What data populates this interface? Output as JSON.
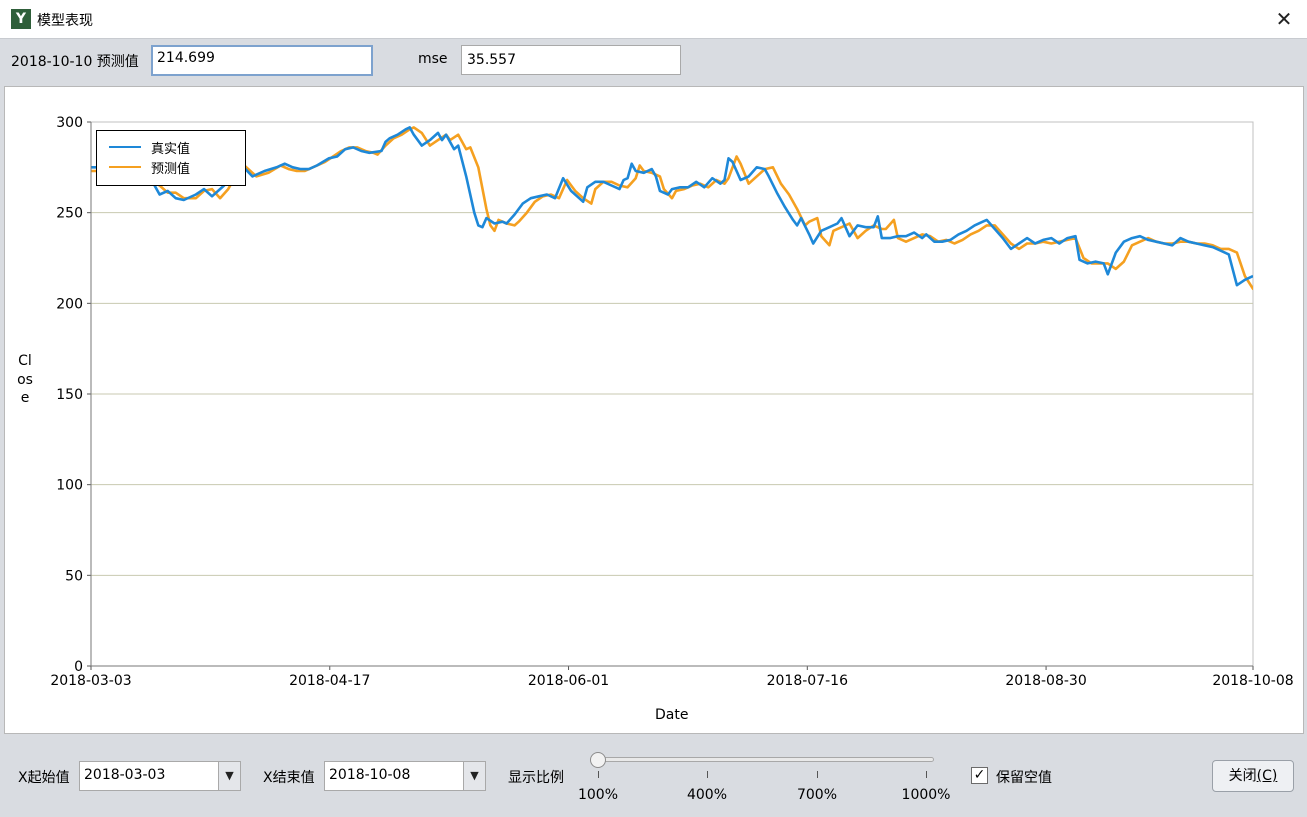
{
  "window": {
    "title": "模型表现",
    "icon_letter": "Y"
  },
  "top": {
    "pred_label": "2018-10-10 预测值",
    "pred_value": "214.699",
    "mse_label": "mse",
    "mse_value": "35.557"
  },
  "chart_data": {
    "type": "line",
    "xlabel": "Date",
    "ylabel": "Close",
    "ylim": [
      0,
      300
    ],
    "yticks": [
      0,
      50,
      100,
      150,
      200,
      250,
      300
    ],
    "xticks": [
      "2018-03-03",
      "2018-04-17",
      "2018-06-01",
      "2018-07-16",
      "2018-08-30",
      "2018-10-08"
    ],
    "x_range": [
      "2018-03-03",
      "2018-10-08"
    ],
    "grid": "horizontal",
    "legend": "top-left",
    "series": [
      {
        "name": "真实值",
        "color": "#1e88d8",
        "values": [
          [
            0,
            275
          ],
          [
            3,
            275
          ],
          [
            6,
            272
          ],
          [
            9,
            274
          ],
          [
            12,
            272
          ],
          [
            15,
            268
          ],
          [
            17,
            260
          ],
          [
            19,
            262
          ],
          [
            21,
            258
          ],
          [
            23,
            257
          ],
          [
            26,
            260
          ],
          [
            28,
            263
          ],
          [
            30,
            259
          ],
          [
            33,
            265
          ],
          [
            35,
            272
          ],
          [
            37,
            277
          ],
          [
            40,
            270
          ],
          [
            43,
            273
          ],
          [
            46,
            275
          ],
          [
            48,
            277
          ],
          [
            50,
            275
          ],
          [
            52,
            274
          ],
          [
            54,
            274
          ],
          [
            56,
            276
          ],
          [
            59,
            280
          ],
          [
            61,
            281
          ],
          [
            63,
            285
          ],
          [
            65,
            286
          ],
          [
            67,
            284
          ],
          [
            69,
            283
          ],
          [
            72,
            284
          ],
          [
            73,
            289
          ],
          [
            74,
            291
          ],
          [
            76,
            293
          ],
          [
            78,
            296
          ],
          [
            79,
            297
          ],
          [
            80,
            293
          ],
          [
            82,
            287
          ],
          [
            84,
            290
          ],
          [
            86,
            294
          ],
          [
            87,
            290
          ],
          [
            88,
            293
          ],
          [
            90,
            285
          ],
          [
            91,
            287
          ],
          [
            93,
            270
          ],
          [
            95,
            250
          ],
          [
            96,
            243
          ],
          [
            97,
            242
          ],
          [
            98,
            247
          ],
          [
            100,
            244
          ],
          [
            102,
            245
          ],
          [
            103,
            244
          ],
          [
            105,
            249
          ],
          [
            107,
            255
          ],
          [
            109,
            258
          ],
          [
            111,
            259
          ],
          [
            113,
            260
          ],
          [
            115,
            258
          ],
          [
            117,
            269
          ],
          [
            119,
            262
          ],
          [
            121,
            258
          ],
          [
            122,
            256
          ],
          [
            123,
            264
          ],
          [
            125,
            267
          ],
          [
            127,
            267
          ],
          [
            129,
            265
          ],
          [
            131,
            263
          ],
          [
            132,
            268
          ],
          [
            133,
            269
          ],
          [
            134,
            277
          ],
          [
            135,
            273
          ],
          [
            137,
            272
          ],
          [
            139,
            274
          ],
          [
            140,
            270
          ],
          [
            141,
            262
          ],
          [
            143,
            260
          ],
          [
            144,
            263
          ],
          [
            146,
            264
          ],
          [
            148,
            264
          ],
          [
            150,
            267
          ],
          [
            152,
            264
          ],
          [
            154,
            269
          ],
          [
            156,
            266
          ],
          [
            157,
            268
          ],
          [
            158,
            280
          ],
          [
            159,
            278
          ],
          [
            161,
            268
          ],
          [
            163,
            270
          ],
          [
            165,
            275
          ],
          [
            167,
            274
          ],
          [
            168,
            270
          ],
          [
            170,
            261
          ],
          [
            172,
            253
          ],
          [
            174,
            246
          ],
          [
            175,
            243
          ],
          [
            176,
            247
          ],
          [
            178,
            238
          ],
          [
            179,
            233
          ],
          [
            181,
            240
          ],
          [
            183,
            242
          ],
          [
            185,
            244
          ],
          [
            186,
            247
          ],
          [
            188,
            237
          ],
          [
            190,
            243
          ],
          [
            192,
            242
          ],
          [
            194,
            242
          ],
          [
            195,
            248
          ],
          [
            196,
            236
          ],
          [
            198,
            236
          ],
          [
            200,
            237
          ],
          [
            202,
            237
          ],
          [
            204,
            239
          ],
          [
            206,
            236
          ],
          [
            207,
            238
          ],
          [
            209,
            234
          ],
          [
            211,
            234
          ],
          [
            213,
            235
          ],
          [
            215,
            238
          ],
          [
            217,
            240
          ],
          [
            219,
            243
          ],
          [
            221,
            245
          ],
          [
            222,
            246
          ],
          [
            224,
            241
          ],
          [
            226,
            236
          ],
          [
            228,
            230
          ],
          [
            230,
            233
          ],
          [
            232,
            236
          ],
          [
            234,
            233
          ],
          [
            236,
            235
          ],
          [
            238,
            236
          ],
          [
            240,
            233
          ],
          [
            242,
            236
          ],
          [
            244,
            237
          ],
          [
            245,
            224
          ],
          [
            247,
            222
          ],
          [
            249,
            223
          ],
          [
            251,
            222
          ],
          [
            252,
            216
          ],
          [
            254,
            228
          ],
          [
            256,
            234
          ],
          [
            258,
            236
          ],
          [
            260,
            237
          ],
          [
            262,
            235
          ],
          [
            264,
            234
          ],
          [
            266,
            233
          ],
          [
            268,
            232
          ],
          [
            270,
            236
          ],
          [
            272,
            234
          ],
          [
            274,
            233
          ],
          [
            276,
            232
          ],
          [
            278,
            231
          ],
          [
            280,
            229
          ],
          [
            282,
            227
          ],
          [
            284,
            210
          ],
          [
            286,
            213
          ],
          [
            288,
            215
          ]
        ]
      },
      {
        "name": "预测值",
        "color": "#f5a020",
        "values": [
          [
            0,
            273
          ],
          [
            3,
            273
          ],
          [
            6,
            273
          ],
          [
            9,
            273
          ],
          [
            12,
            270
          ],
          [
            15,
            268
          ],
          [
            17,
            265
          ],
          [
            19,
            261
          ],
          [
            21,
            261
          ],
          [
            23,
            258
          ],
          [
            26,
            258
          ],
          [
            28,
            262
          ],
          [
            30,
            263
          ],
          [
            32,
            258
          ],
          [
            34,
            263
          ],
          [
            36,
            271
          ],
          [
            38,
            276
          ],
          [
            41,
            270
          ],
          [
            44,
            272
          ],
          [
            47,
            276
          ],
          [
            49,
            274
          ],
          [
            51,
            273
          ],
          [
            53,
            273
          ],
          [
            55,
            275
          ],
          [
            58,
            278
          ],
          [
            60,
            281
          ],
          [
            62,
            284
          ],
          [
            64,
            286
          ],
          [
            66,
            286
          ],
          [
            68,
            284
          ],
          [
            70,
            283
          ],
          [
            71,
            282
          ],
          [
            73,
            287
          ],
          [
            75,
            291
          ],
          [
            77,
            293
          ],
          [
            79,
            296
          ],
          [
            80,
            297
          ],
          [
            82,
            294
          ],
          [
            84,
            287
          ],
          [
            86,
            290
          ],
          [
            88,
            293
          ],
          [
            89,
            290
          ],
          [
            91,
            293
          ],
          [
            93,
            285
          ],
          [
            94,
            286
          ],
          [
            96,
            275
          ],
          [
            98,
            252
          ],
          [
            99,
            243
          ],
          [
            100,
            240
          ],
          [
            101,
            246
          ],
          [
            103,
            244
          ],
          [
            105,
            243
          ],
          [
            106,
            245
          ],
          [
            108,
            250
          ],
          [
            110,
            256
          ],
          [
            112,
            259
          ],
          [
            114,
            260
          ],
          [
            116,
            258
          ],
          [
            118,
            268
          ],
          [
            120,
            262
          ],
          [
            122,
            258
          ],
          [
            124,
            255
          ],
          [
            125,
            263
          ],
          [
            127,
            267
          ],
          [
            129,
            267
          ],
          [
            131,
            265
          ],
          [
            133,
            264
          ],
          [
            135,
            269
          ],
          [
            136,
            276
          ],
          [
            137,
            273
          ],
          [
            139,
            272
          ],
          [
            141,
            270
          ],
          [
            142,
            263
          ],
          [
            144,
            258
          ],
          [
            145,
            262
          ],
          [
            147,
            263
          ],
          [
            149,
            265
          ],
          [
            151,
            266
          ],
          [
            153,
            264
          ],
          [
            155,
            268
          ],
          [
            157,
            266
          ],
          [
            158,
            269
          ],
          [
            160,
            281
          ],
          [
            161,
            277
          ],
          [
            163,
            266
          ],
          [
            165,
            270
          ],
          [
            167,
            274
          ],
          [
            169,
            275
          ],
          [
            171,
            266
          ],
          [
            173,
            260
          ],
          [
            175,
            252
          ],
          [
            177,
            243
          ],
          [
            178,
            245
          ],
          [
            180,
            247
          ],
          [
            181,
            237
          ],
          [
            183,
            232
          ],
          [
            184,
            240
          ],
          [
            186,
            242
          ],
          [
            188,
            244
          ],
          [
            190,
            236
          ],
          [
            192,
            240
          ],
          [
            194,
            243
          ],
          [
            196,
            241
          ],
          [
            197,
            241
          ],
          [
            199,
            246
          ],
          [
            200,
            236
          ],
          [
            202,
            234
          ],
          [
            204,
            236
          ],
          [
            206,
            238
          ],
          [
            208,
            237
          ],
          [
            210,
            234
          ],
          [
            212,
            235
          ],
          [
            214,
            233
          ],
          [
            216,
            235
          ],
          [
            218,
            238
          ],
          [
            220,
            240
          ],
          [
            222,
            243
          ],
          [
            224,
            243
          ],
          [
            226,
            238
          ],
          [
            228,
            233
          ],
          [
            230,
            230
          ],
          [
            232,
            233
          ],
          [
            234,
            233
          ],
          [
            236,
            234
          ],
          [
            238,
            233
          ],
          [
            240,
            234
          ],
          [
            242,
            235
          ],
          [
            244,
            236
          ],
          [
            246,
            225
          ],
          [
            248,
            222
          ],
          [
            250,
            222
          ],
          [
            252,
            222
          ],
          [
            254,
            219
          ],
          [
            256,
            223
          ],
          [
            258,
            232
          ],
          [
            260,
            234
          ],
          [
            262,
            236
          ],
          [
            264,
            234
          ],
          [
            266,
            233
          ],
          [
            268,
            233
          ],
          [
            270,
            234
          ],
          [
            272,
            234
          ],
          [
            274,
            233
          ],
          [
            276,
            233
          ],
          [
            278,
            232
          ],
          [
            280,
            230
          ],
          [
            282,
            230
          ],
          [
            284,
            228
          ],
          [
            286,
            215
          ],
          [
            288,
            208
          ],
          [
            290,
            210
          ]
        ]
      }
    ]
  },
  "bottom": {
    "x_start_label": "X起始值",
    "x_start_value": "2018-03-03",
    "x_end_label": "X结束值",
    "x_end_value": "2018-10-08",
    "scale_label": "显示比例",
    "scale_ticks": [
      "100%",
      "400%",
      "700%",
      "1000%"
    ],
    "scale_value": "100%",
    "keep_null_label": "保留空值",
    "keep_null_checked": true,
    "close_button": "关闭",
    "close_mnemonic": "(C)"
  }
}
